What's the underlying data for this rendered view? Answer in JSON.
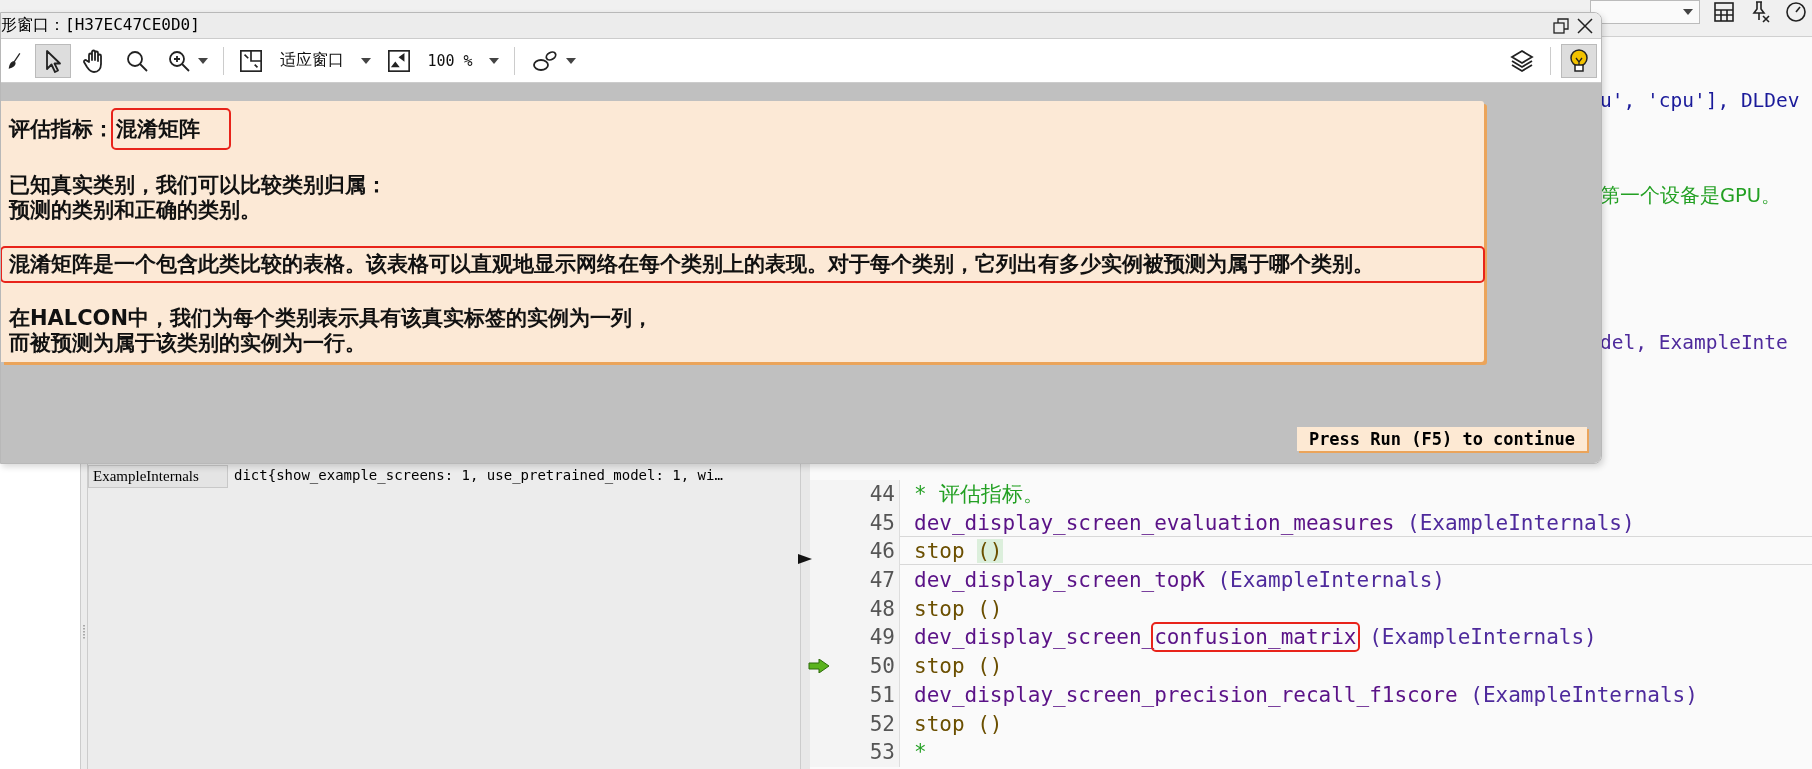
{
  "ide_toolbar": {
    "icons": [
      {
        "kind": "table"
      },
      {
        "kind": "pin"
      },
      {
        "kind": "gauge"
      }
    ]
  },
  "graphics_window": {
    "title": "形窗口：[H37EC47CE0D0]",
    "tools": [
      {
        "kind": "brush",
        "selected": false,
        "dropdown": false
      },
      {
        "kind": "pointer",
        "selected": true,
        "dropdown": false
      },
      {
        "kind": "hand",
        "selected": false,
        "dropdown": false
      },
      {
        "kind": "search",
        "selected": false,
        "dropdown": false
      },
      {
        "kind": "zoom-in",
        "selected": false,
        "dropdown": true
      },
      {
        "kind": "separator"
      },
      {
        "kind": "fit",
        "label": "适应窗口",
        "selected": false,
        "dropdown": true
      },
      {
        "kind": "zoom",
        "label": "100 %",
        "selected": false,
        "dropdown": true
      },
      {
        "kind": "separator"
      },
      {
        "kind": "shapes",
        "selected": false,
        "dropdown": true
      }
    ],
    "right_tools": [
      {
        "kind": "layers",
        "selected": false
      },
      {
        "kind": "separator"
      },
      {
        "kind": "bulb",
        "selected": true
      }
    ],
    "card": {
      "title_label": "评估指标：",
      "title": "混淆矩阵",
      "title_highlighted": true,
      "paragraphs": [
        {
          "lines": [
            "已知真实类别，我们可以比较类别归属：",
            "预测的类别和正确的类别。"
          ],
          "highlighted": false
        },
        {
          "lines": [
            "混淆矩阵是一个包含此类比较的表格。该表格可以直观地显示网络在每个类别上的表现。对于每个类别，它列出有多少实例被预测为属于哪个类别。"
          ],
          "highlighted": true
        },
        {
          "lines": [
            "在HALCON中，我们为每个类别表示具有该真实标签的实例为一列，",
            "而被预测为属于该类别的实例为一行。"
          ],
          "highlighted": false
        }
      ]
    },
    "continue_button": "Press Run (F5) to continue"
  },
  "variables": {
    "rows": [
      {
        "name": "ExampleInternals",
        "value": "dict{show_example_screens: 1, use_pretrained_model: 1, wi…"
      }
    ]
  },
  "editor": {
    "fragments": [
      {
        "text": "u', 'cpu'], DLDev",
        "kind": "string"
      },
      {
        "text": "第一个设备是GPU。",
        "kind": "comment"
      },
      {
        "text": "del, ExampleInte",
        "kind": "args"
      }
    ],
    "lines": [
      {
        "number": "44",
        "current": false,
        "cursor": false,
        "pc": false,
        "tokens": [
          {
            "text": "* 评估指标。",
            "kind": "comment",
            "highlighted": false,
            "matched": false
          }
        ]
      },
      {
        "number": "45",
        "current": false,
        "cursor": false,
        "pc": false,
        "tokens": [
          {
            "text": "dev_display_screen_evaluation_measures",
            "kind": "proc",
            "highlighted": false,
            "matched": false
          },
          {
            "text": " (ExampleInternals)",
            "kind": "args",
            "highlighted": false,
            "matched": false
          }
        ]
      },
      {
        "number": "46",
        "current": true,
        "cursor": true,
        "pc": false,
        "tokens": [
          {
            "text": "stop ",
            "kind": "keyword",
            "highlighted": false,
            "matched": false
          },
          {
            "text": "()",
            "kind": "keyword",
            "highlighted": false,
            "matched": true
          }
        ]
      },
      {
        "number": "47",
        "current": false,
        "cursor": false,
        "pc": false,
        "tokens": [
          {
            "text": "dev_display_screen_topK",
            "kind": "proc",
            "highlighted": false,
            "matched": false
          },
          {
            "text": " (ExampleInternals)",
            "kind": "args",
            "highlighted": false,
            "matched": false
          }
        ]
      },
      {
        "number": "48",
        "current": false,
        "cursor": false,
        "pc": false,
        "tokens": [
          {
            "text": "stop ()",
            "kind": "keyword",
            "highlighted": false,
            "matched": false
          }
        ]
      },
      {
        "number": "49",
        "current": false,
        "cursor": false,
        "pc": false,
        "tokens": [
          {
            "text": "dev_display_screen_",
            "kind": "proc",
            "highlighted": false,
            "matched": false
          },
          {
            "text": "confusion_matrix",
            "kind": "proc",
            "highlighted": true,
            "matched": false
          },
          {
            "text": " (ExampleInternals)",
            "kind": "args",
            "highlighted": false,
            "matched": false
          }
        ]
      },
      {
        "number": "50",
        "current": false,
        "cursor": false,
        "pc": true,
        "tokens": [
          {
            "text": "stop ()",
            "kind": "keyword",
            "highlighted": false,
            "matched": false
          }
        ]
      },
      {
        "number": "51",
        "current": false,
        "cursor": false,
        "pc": false,
        "tokens": [
          {
            "text": "dev_display_screen_precision_recall_f1score",
            "kind": "proc",
            "highlighted": false,
            "matched": false
          },
          {
            "text": " (ExampleInternals)",
            "kind": "args",
            "highlighted": false,
            "matched": false
          }
        ]
      },
      {
        "number": "52",
        "current": false,
        "cursor": false,
        "pc": false,
        "tokens": [
          {
            "text": "stop ()",
            "kind": "keyword",
            "highlighted": false,
            "matched": false
          }
        ]
      },
      {
        "number": "53",
        "current": false,
        "cursor": false,
        "pc": false,
        "tokens": [
          {
            "text": "*",
            "kind": "comment",
            "highlighted": false,
            "matched": false
          }
        ]
      }
    ]
  }
}
